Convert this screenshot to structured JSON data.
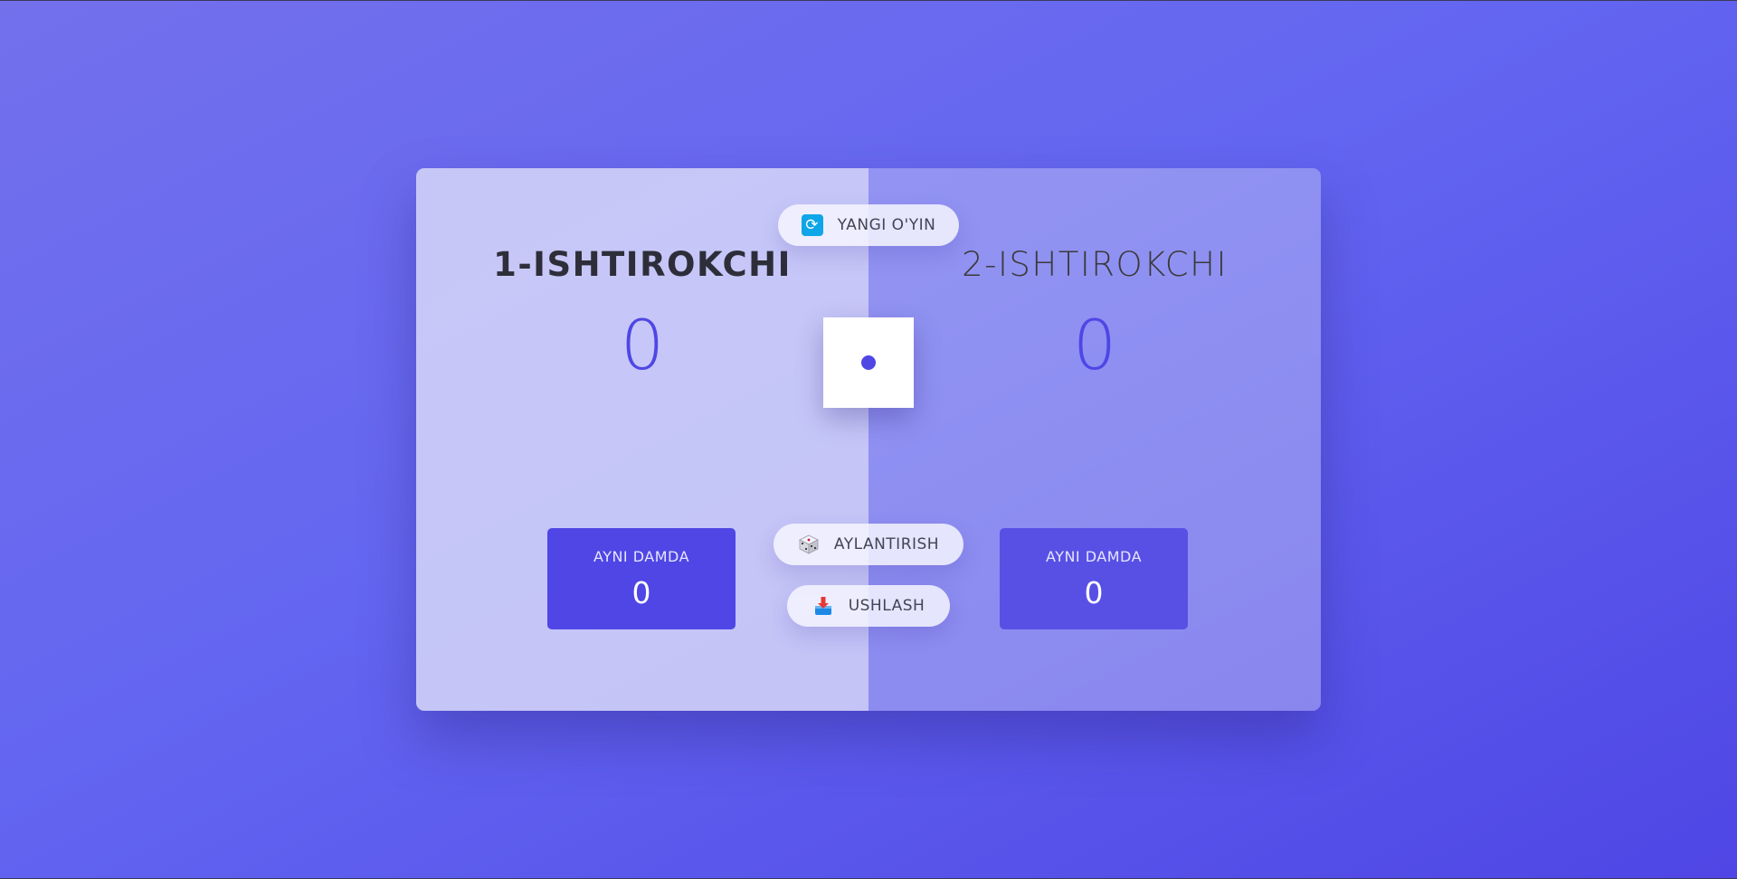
{
  "players": [
    {
      "name": "1-ISHTIROKCHI",
      "score": "0",
      "current_label": "AYNI DAMDA",
      "current_score": "0",
      "active": true
    },
    {
      "name": "2-ISHTIROKCHI",
      "score": "0",
      "current_label": "AYNI DAMDA",
      "current_score": "0",
      "active": false
    }
  ],
  "buttons": {
    "new_game": {
      "label": "YANGI O'YIN",
      "icon": "refresh-icon"
    },
    "roll": {
      "label": "AYLANTIRISH",
      "icon": "dice-icon"
    },
    "hold": {
      "label": "USHLASH",
      "icon": "inbox-tray-icon"
    }
  },
  "dice": {
    "value": 1
  },
  "colors": {
    "accent": "#4f46e5",
    "active_panel": "#e5e5fa",
    "current_box": "#4f46e5"
  }
}
